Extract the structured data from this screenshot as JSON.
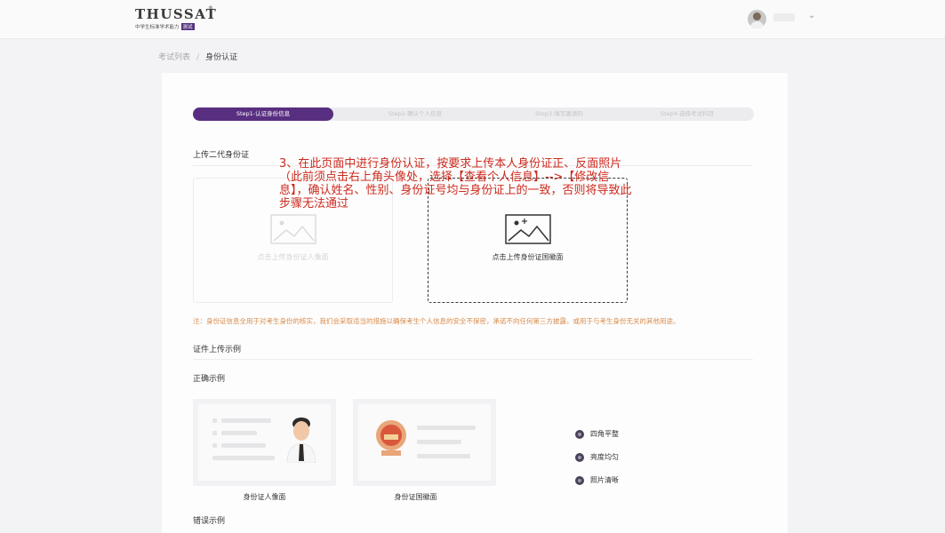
{
  "header": {
    "logo_title": "THUSSAT",
    "logo_reg": "®",
    "logo_subtitle": "中学生标准学术能力",
    "logo_badge": "测试"
  },
  "breadcrumb": {
    "parent": "考试列表",
    "separator": "/",
    "current": "身份认证"
  },
  "steps": [
    {
      "label": "Step1-认证身份信息",
      "active": true
    },
    {
      "label": "Step2-确认个人信息",
      "active": false
    },
    {
      "label": "Step3-填写邀请码",
      "active": false
    },
    {
      "label": "Step4-选择考试科目",
      "active": false
    }
  ],
  "upload_section": {
    "title": "上传二代身份证",
    "front_caption": "点击上传身份证人像面",
    "back_caption": "点击上传身份证国徽面"
  },
  "annotation": "3、在此页面中进行身份认证，按要求上传本人身份证正、反面照片（此前须点击右上角头像处，选择【查看个人信息】-->【修改信息】，确认姓名、性别、身份证号均与身份证上的一致，否则将导致此步骤无法通过",
  "notice": "注：身份证信息全用于对考生身份的核实，我们会采取适当的措施以确保考生个人信息的安全不保密，承诺不向任何第三方披露，或用于与考生身份无关的其他用途。",
  "example_section": {
    "title": "证件上传示例",
    "correct_label": "正确示例",
    "wrong_label": "错误示例",
    "front_caption": "身份证人像面",
    "back_caption": "身份证国徽面",
    "checks": [
      "四角平整",
      "亮度均匀",
      "照片清晰"
    ]
  },
  "colors": {
    "accent": "#582f80",
    "annotation": "#cc2a1e",
    "notice": "#d98a4a"
  }
}
